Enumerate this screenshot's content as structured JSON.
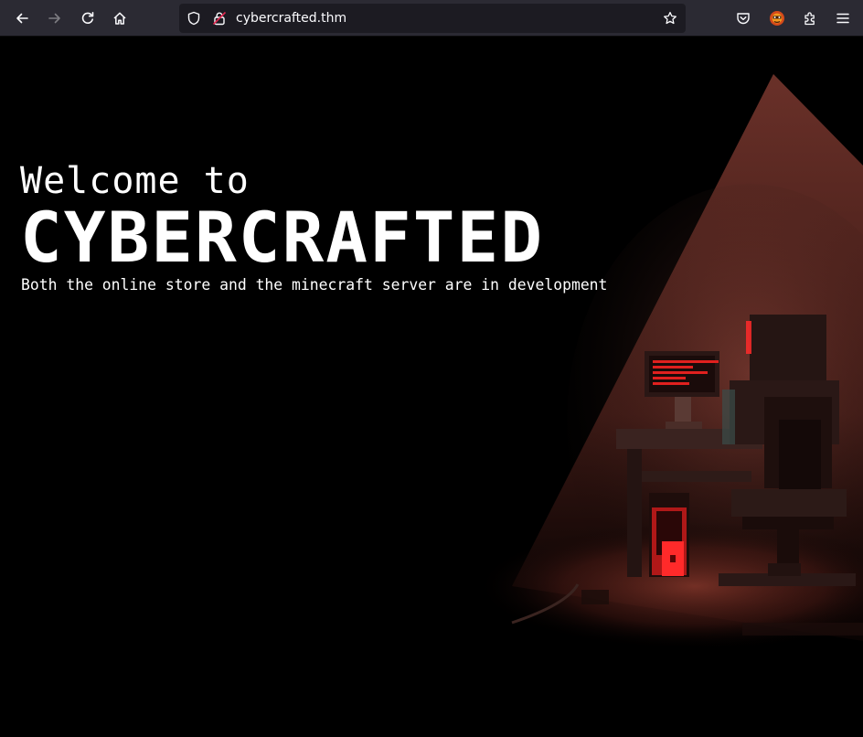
{
  "browser": {
    "url": "cybercrafted.thm",
    "icons": {
      "back": "arrow-left-icon",
      "forward": "arrow-right-icon",
      "reload": "reload-icon",
      "home": "home-icon",
      "tracking": "shield-icon",
      "connection": "insecure-lock-icon",
      "bookmark": "star-icon",
      "pocket": "pocket-icon",
      "extension_badge": "hackbar-extension-icon",
      "extensions": "puzzle-icon",
      "menu": "hamburger-menu-icon"
    }
  },
  "hero": {
    "welcome": "Welcome to",
    "title": "CYBERCRAFTED",
    "subtitle": "Both the online store and the minecraft server are in development"
  },
  "colors": {
    "toolbar_bg": "#2b2a33",
    "urlbar_bg": "#1c1b22",
    "page_bg": "#000000",
    "accent_red": "#e0201e",
    "spotlight": "#a0443a"
  }
}
